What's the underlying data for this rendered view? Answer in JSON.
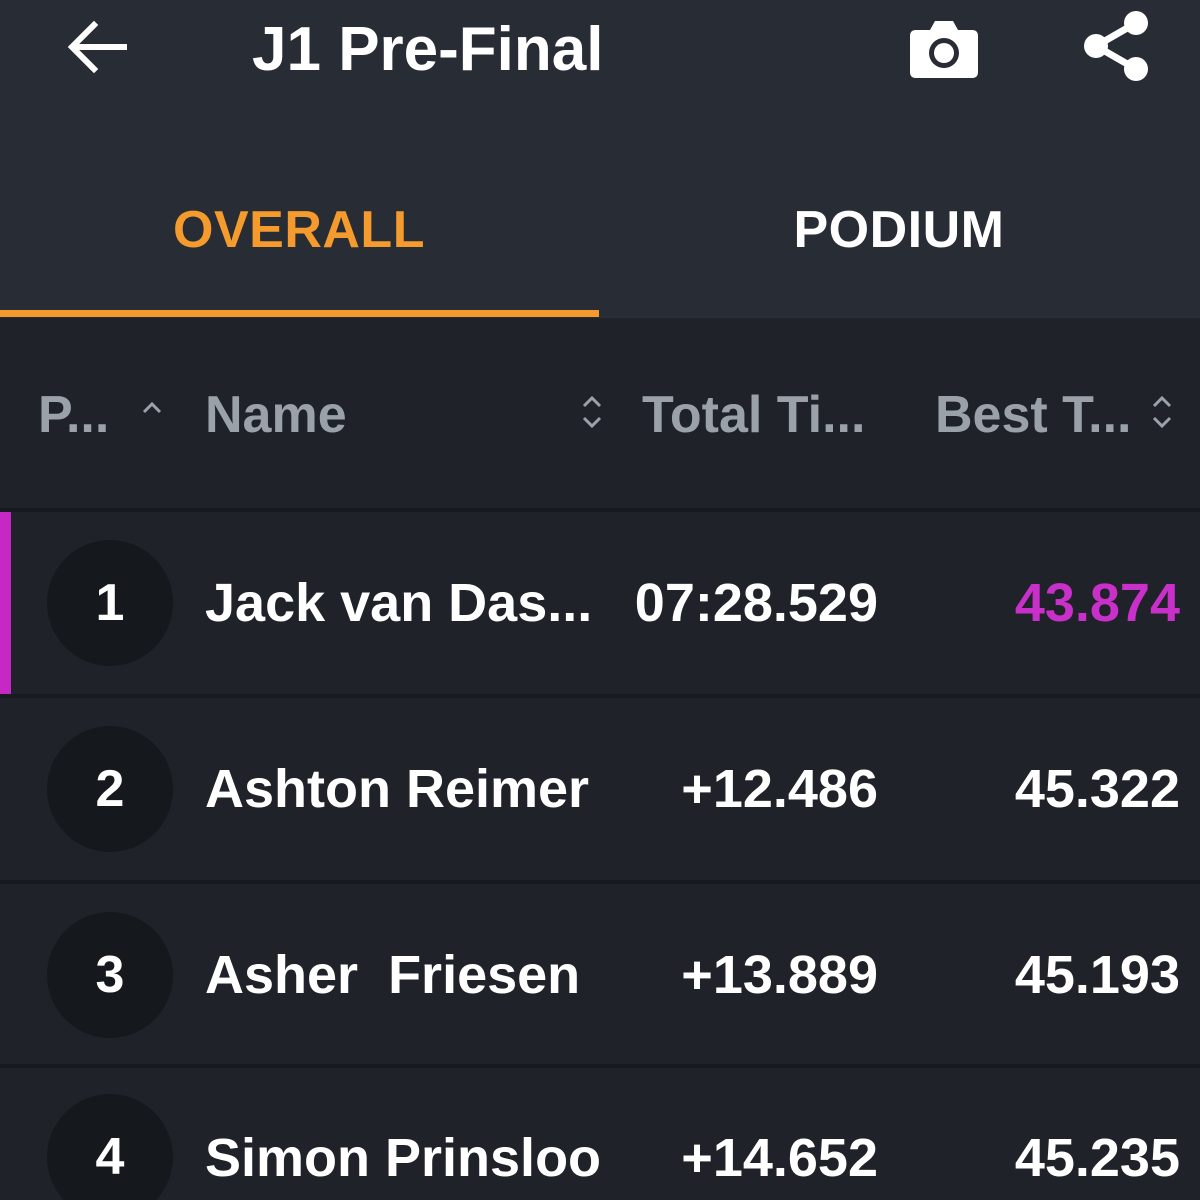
{
  "header": {
    "title": "J1 Pre-Final",
    "back_icon": "arrow-left-icon",
    "camera_icon": "camera-icon",
    "share_icon": "share-icon"
  },
  "tabs": [
    {
      "label": "OVERALL",
      "active": true
    },
    {
      "label": "PODIUM",
      "active": false
    }
  ],
  "columns": {
    "position": "P...",
    "name": "Name",
    "total_time": "Total Ti...",
    "best_time": "Best T..."
  },
  "rows": [
    {
      "position": "1",
      "name": "Jack van Das...",
      "total_time": "07:28.529",
      "best_time": "43.874",
      "fastest_lap": true
    },
    {
      "position": "2",
      "name": "Ashton Reimer",
      "total_time": "+12.486",
      "best_time": "45.322",
      "fastest_lap": false
    },
    {
      "position": "3",
      "name": "Asher  Friesen",
      "total_time": "+13.889",
      "best_time": "45.193",
      "fastest_lap": false
    },
    {
      "position": "4",
      "name": "Simon Prinsloo",
      "total_time": "+14.652",
      "best_time": "45.235",
      "fastest_lap": false
    }
  ],
  "colors": {
    "accent": "#f59a2c",
    "fastest": "#c930c9",
    "appbar": "#282c35",
    "background": "#1f2329"
  }
}
